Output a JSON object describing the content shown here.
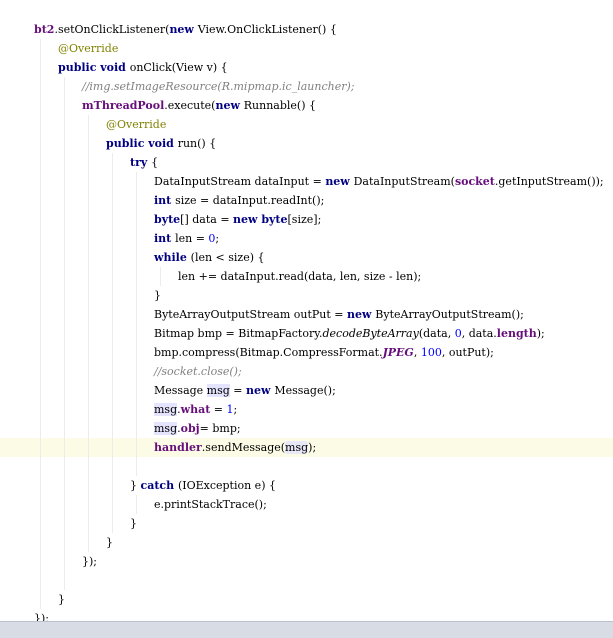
{
  "editor": {
    "lines": [
      {
        "indent": 0,
        "tokens": [
          [
            "fld",
            "bt2"
          ],
          [
            "",
            "."
          ],
          [
            "",
            "setOnClickListener("
          ],
          [
            "kw",
            "new "
          ],
          [
            "",
            "View.OnClickListener() {"
          ]
        ]
      },
      {
        "indent": 1,
        "tokens": [
          [
            "ann",
            "@Override"
          ]
        ]
      },
      {
        "indent": 1,
        "tokens": [
          [
            "kw",
            "public void "
          ],
          [
            "",
            "onClick(View v) {"
          ]
        ]
      },
      {
        "indent": 2,
        "tokens": [
          [
            "cmt",
            "//img.setImageResource(R.mipmap.ic_launcher);"
          ]
        ]
      },
      {
        "indent": 2,
        "tokens": [
          [
            "fld",
            "mThreadPool"
          ],
          [
            "",
            ".execute("
          ],
          [
            "kw",
            "new "
          ],
          [
            "",
            "Runnable() {"
          ]
        ]
      },
      {
        "indent": 3,
        "tokens": [
          [
            "ann",
            "@Override"
          ]
        ]
      },
      {
        "indent": 3,
        "tokens": [
          [
            "kw",
            "public void "
          ],
          [
            "",
            "run() {"
          ]
        ]
      },
      {
        "indent": 4,
        "tokens": [
          [
            "kw",
            "try "
          ],
          [
            "",
            "{"
          ]
        ]
      },
      {
        "indent": 5,
        "tokens": [
          [
            "",
            "DataInputStream dataInput = "
          ],
          [
            "kw",
            "new "
          ],
          [
            "",
            "DataInputStream("
          ],
          [
            "fld",
            "socket"
          ],
          [
            "",
            ".getInputStream());"
          ]
        ]
      },
      {
        "indent": 5,
        "tokens": [
          [
            "kw",
            "int "
          ],
          [
            "",
            "size = dataInput.readInt();"
          ]
        ]
      },
      {
        "indent": 5,
        "tokens": [
          [
            "kw",
            "byte"
          ],
          [
            "",
            "[] data = "
          ],
          [
            "kw",
            "new byte"
          ],
          [
            "",
            "[size];"
          ]
        ]
      },
      {
        "indent": 5,
        "tokens": [
          [
            "kw",
            "int "
          ],
          [
            "",
            "len = "
          ],
          [
            "num",
            "0"
          ],
          [
            "",
            ";"
          ]
        ]
      },
      {
        "indent": 5,
        "tokens": [
          [
            "kw",
            "while "
          ],
          [
            "",
            "(len < size) {"
          ]
        ]
      },
      {
        "indent": 6,
        "tokens": [
          [
            "",
            "len += dataInput.read(data, len, size - len);"
          ]
        ]
      },
      {
        "indent": 5,
        "tokens": [
          [
            "",
            "}"
          ]
        ]
      },
      {
        "indent": 5,
        "tokens": [
          [
            "",
            "ByteArrayOutputStream outPut = "
          ],
          [
            "kw",
            "new "
          ],
          [
            "",
            "ByteArrayOutputStream();"
          ]
        ]
      },
      {
        "indent": 5,
        "tokens": [
          [
            "",
            "Bitmap bmp = BitmapFactory."
          ],
          [
            "stat",
            "decodeByteArray"
          ],
          [
            "",
            "(data, "
          ],
          [
            "num",
            "0"
          ],
          [
            "",
            ", data."
          ],
          [
            "fld",
            "length"
          ],
          [
            "",
            ");"
          ]
        ]
      },
      {
        "indent": 5,
        "tokens": [
          [
            "",
            "bmp.compress(Bitmap.CompressFormat."
          ],
          [
            "statfld",
            "JPEG"
          ],
          [
            "",
            ", "
          ],
          [
            "num",
            "100"
          ],
          [
            "",
            ", outPut);"
          ]
        ]
      },
      {
        "indent": 5,
        "tokens": [
          [
            "cmt",
            "//socket.close();"
          ]
        ]
      },
      {
        "indent": 5,
        "tokens": [
          [
            "",
            "Message "
          ],
          [
            "hl",
            "msg"
          ],
          [
            "",
            " = "
          ],
          [
            "kw",
            "new "
          ],
          [
            "",
            "Message();"
          ]
        ]
      },
      {
        "indent": 5,
        "tokens": [
          [
            "hl",
            "msg"
          ],
          [
            "",
            "."
          ],
          [
            "fld",
            "what"
          ],
          [
            "",
            " = "
          ],
          [
            "num",
            "1"
          ],
          [
            "",
            ";"
          ]
        ]
      },
      {
        "indent": 5,
        "tokens": [
          [
            "hl",
            "msg"
          ],
          [
            "",
            "."
          ],
          [
            "fld",
            "obj"
          ],
          [
            "",
            "",
            " "
          ],
          [
            "",
            "= bmp;"
          ]
        ]
      },
      {
        "indent": 5,
        "current": true,
        "tokens": [
          [
            "fld",
            "handler"
          ],
          [
            "",
            ".sendMessage("
          ],
          [
            "hlb",
            "msg"
          ],
          [
            "",
            ");"
          ]
        ]
      },
      {
        "indent": 5,
        "tokens": []
      },
      {
        "indent": 4,
        "tokens": [
          [
            "",
            "} "
          ],
          [
            "kw",
            "catch "
          ],
          [
            "",
            "(IOException e) {"
          ]
        ]
      },
      {
        "indent": 5,
        "tokens": [
          [
            "",
            "e.printStackTrace();"
          ]
        ]
      },
      {
        "indent": 4,
        "tokens": [
          [
            "",
            "}"
          ]
        ]
      },
      {
        "indent": 3,
        "tokens": [
          [
            "",
            "}"
          ]
        ]
      },
      {
        "indent": 2,
        "tokens": [
          [
            "",
            "});"
          ]
        ]
      },
      {
        "indent": 2,
        "tokens": []
      },
      {
        "indent": 1,
        "tokens": [
          [
            "",
            "}"
          ]
        ]
      },
      {
        "indent": 0,
        "tokens": [
          [
            "",
            "});"
          ]
        ]
      }
    ]
  },
  "colors": {
    "keyword": "#000080",
    "annotation": "#808000",
    "comment": "#808080",
    "field": "#660e7a",
    "number": "#0000ff",
    "current_line": "#fcfbe6",
    "status_bar": "#d8dde5"
  }
}
